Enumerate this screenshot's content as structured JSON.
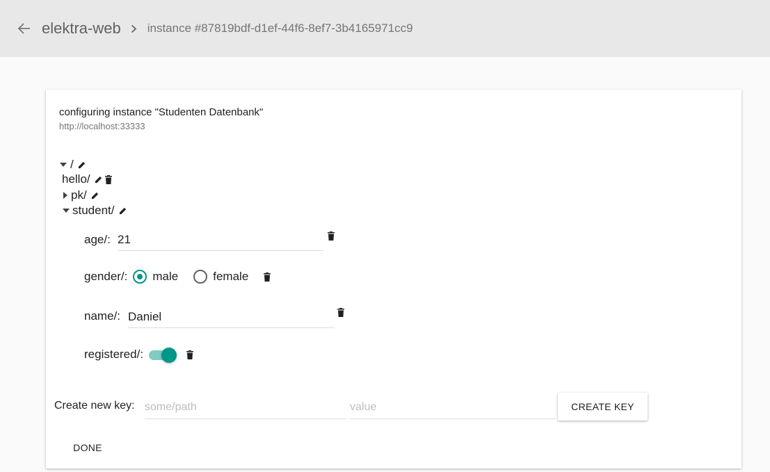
{
  "header": {
    "app_name": "elektra-web",
    "instance_label": "instance #87819bdf-d1ef-44f6-8ef7-3b4165971cc9"
  },
  "card": {
    "title": "configuring instance \"Studenten Datenbank\"",
    "url": "http://localhost:33333"
  },
  "tree": {
    "root": "/",
    "hello": "hello/",
    "pk": "pk/",
    "student": "student/",
    "age": {
      "label": "age/:",
      "value": "21"
    },
    "gender": {
      "label": "gender/:",
      "options": [
        "male",
        "female"
      ],
      "selected": "male"
    },
    "name": {
      "label": "name/:",
      "value": "Daniel"
    },
    "registered": {
      "label": "registered/:",
      "checked": true
    }
  },
  "create": {
    "label": "Create new key:",
    "path_placeholder": "some/path",
    "value_placeholder": "value",
    "button": "CREATE KEY"
  },
  "footer": {
    "done": "DONE"
  },
  "colors": {
    "accent": "#009688",
    "accent_light": "#80cbc4",
    "header_bg": "#e8e8e8"
  },
  "icons": [
    "arrow-back-icon",
    "chevron-right-icon",
    "caret-down-icon",
    "caret-right-icon",
    "pencil-icon",
    "trash-icon"
  ]
}
